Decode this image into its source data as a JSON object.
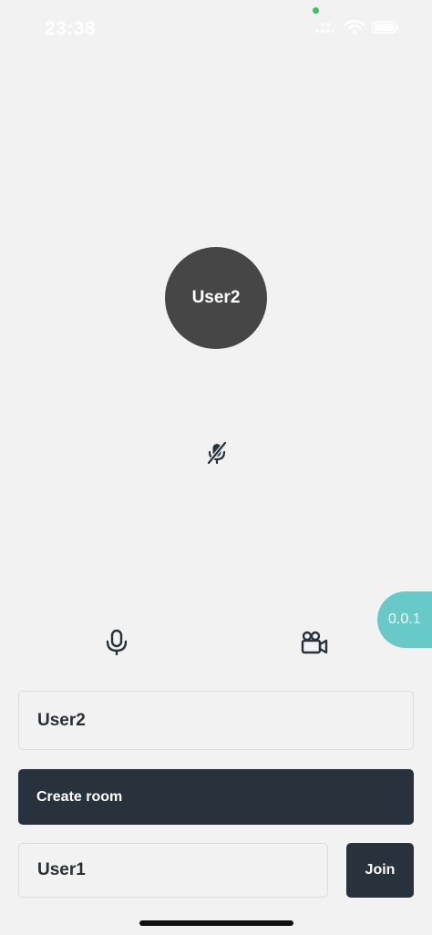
{
  "status_bar": {
    "time": "23:38",
    "icons": [
      "cellular-signal-icon",
      "wifi-icon",
      "battery-icon"
    ]
  },
  "call": {
    "remote_participant_name": "User2",
    "remote_mic_status_icon": "mic-muted-icon"
  },
  "version_badge": "0.0.1",
  "controls": {
    "mic_icon": "microphone-icon",
    "camera_icon": "video-camera-icon"
  },
  "form": {
    "room_name_value": "User2",
    "create_room_label": "Create room",
    "join_name_value": "User1",
    "join_label": "Join"
  },
  "colors": {
    "background": "#f2f2f2",
    "avatar": "#464646",
    "primary_button": "#27323c",
    "version_badge": "#68c9c9",
    "privacy_dot": "#34c759"
  }
}
